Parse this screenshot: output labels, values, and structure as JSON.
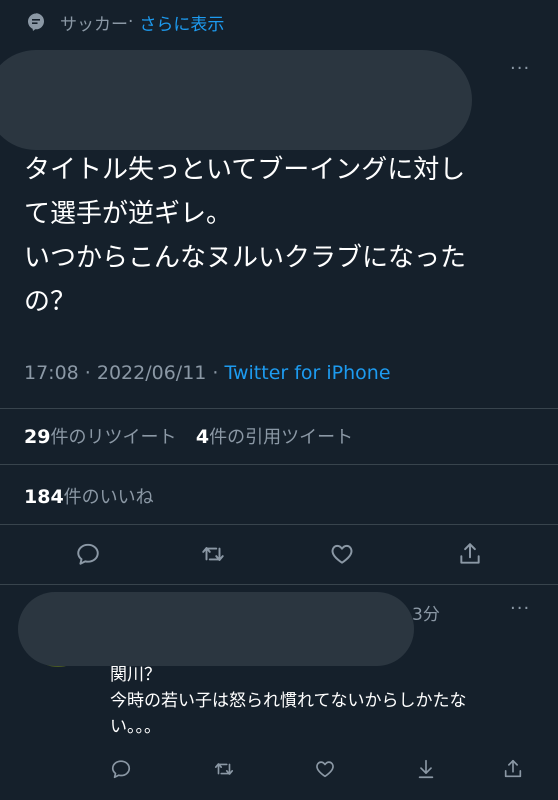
{
  "topic": {
    "label": "サッカー",
    "separator": " · ",
    "more": "さらに表示"
  },
  "tweet": {
    "text": "タイトル失っといてブーイングに対し\nて選手が逆ギレ。\nいつからこんなヌルいクラブになった\nの？",
    "time": "17:08 · 2022/06/11 · ",
    "source": "Twitter for iPhone",
    "retweets_count": "29",
    "retweets_label": "件のリツイート",
    "quotes_count": "4",
    "quotes_label": "件の引用ツイート",
    "likes_count": "184",
    "likes_label": "件のいいね",
    "more_glyph": "···"
  },
  "reply": {
    "time": "3分",
    "text": "関川？\n今時の若い子は怒られ慣れてないからしかたな\nい。。。",
    "more_glyph": "···"
  },
  "icons": {
    "topic": "topic-bubble-icon",
    "reply": "reply-icon",
    "retweet": "retweet-icon",
    "like": "heart-icon",
    "share": "share-icon",
    "download": "download-icon"
  },
  "colors": {
    "background": "#15202b",
    "accent": "#1d9bf0",
    "muted": "#8b98a5",
    "divider": "#38444d"
  }
}
